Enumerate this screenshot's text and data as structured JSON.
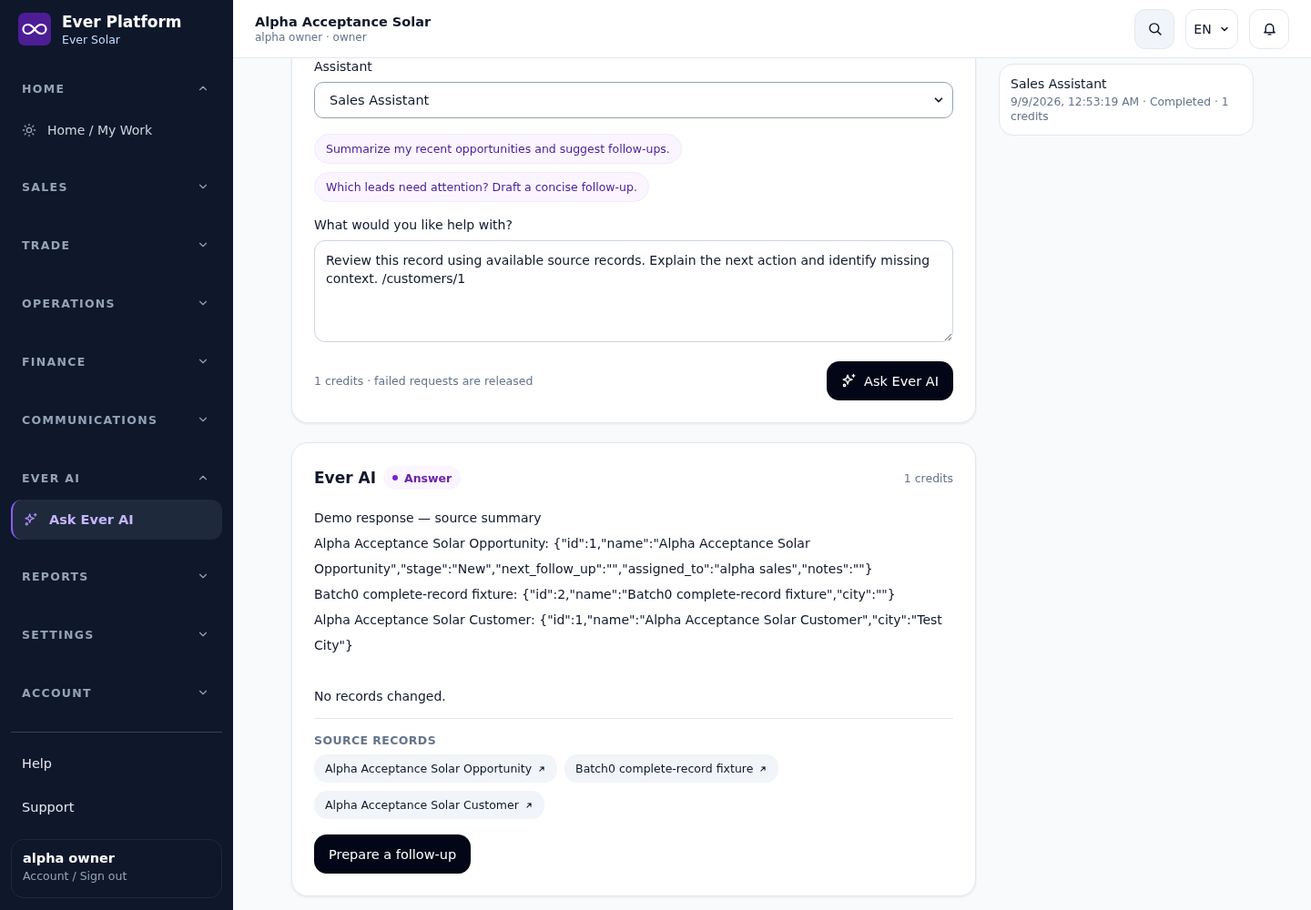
{
  "brand": {
    "name": "Ever Platform",
    "org": "Ever Solar"
  },
  "sidebar": {
    "sections": [
      {
        "label": "HOME",
        "expanded": true,
        "items": [
          {
            "label": "Home / My Work",
            "selected": false
          }
        ]
      },
      {
        "label": "SALES",
        "expanded": false
      },
      {
        "label": "TRADE",
        "expanded": false
      },
      {
        "label": "OPERATIONS",
        "expanded": false
      },
      {
        "label": "FINANCE",
        "expanded": false
      },
      {
        "label": "COMMUNICATIONS",
        "expanded": false
      },
      {
        "label": "EVER AI",
        "expanded": true,
        "items": [
          {
            "label": "Ask Ever AI",
            "selected": true
          }
        ]
      },
      {
        "label": "REPORTS",
        "expanded": false
      },
      {
        "label": "SETTINGS",
        "expanded": false
      },
      {
        "label": "ACCOUNT",
        "expanded": false
      }
    ],
    "links": [
      "Help",
      "Support"
    ],
    "user": {
      "name": "alpha owner",
      "action": "Account / Sign out"
    }
  },
  "header": {
    "title": "Alpha Acceptance Solar",
    "subtitle": "alpha owner · owner",
    "language": "EN"
  },
  "ask_card": {
    "assistant_label": "Assistant",
    "assistant": "Sales Assistant",
    "suggestions": [
      "Summarize my recent opportunities and suggest follow-ups.",
      "Which leads need attention? Draft a concise follow-up."
    ],
    "prompt_label": "What would you like help with?",
    "prompt": "Review this record using available source records. Explain the next action and identify missing context. /customers/1",
    "credit_note": "1 credits · failed requests are released",
    "submit": "Ask Ever AI"
  },
  "answer_card": {
    "title": "Ever AI",
    "badge": "Answer",
    "credits": "1 credits",
    "response_lines": [
      "Demo response — source summary",
      "Alpha Acceptance Solar Opportunity: {\"id\":1,\"name\":\"Alpha Acceptance Solar Opportunity\",\"stage\":\"New\",\"next_follow_up\":\"\",\"assigned_to\":\"alpha sales\",\"notes\":\"\"}",
      "Batch0 complete-record fixture: {\"id\":2,\"name\":\"Batch0 complete-record fixture\",\"city\":\"\"}",
      "Alpha Acceptance Solar Customer: {\"id\":1,\"name\":\"Alpha Acceptance Solar Customer\",\"city\":\"Test City\"}"
    ],
    "change_note": "No records changed.",
    "sources_heading": "SOURCE RECORDS",
    "sources": [
      "Alpha Acceptance Solar Opportunity",
      "Batch0 complete-record fixture",
      "Alpha Acceptance Solar Customer"
    ],
    "action": "Prepare a follow-up"
  },
  "history": [
    {
      "title": "Sales Assistant",
      "meta": "9/9/2026, 12:53:19 AM · Completed · 1 credits"
    }
  ]
}
